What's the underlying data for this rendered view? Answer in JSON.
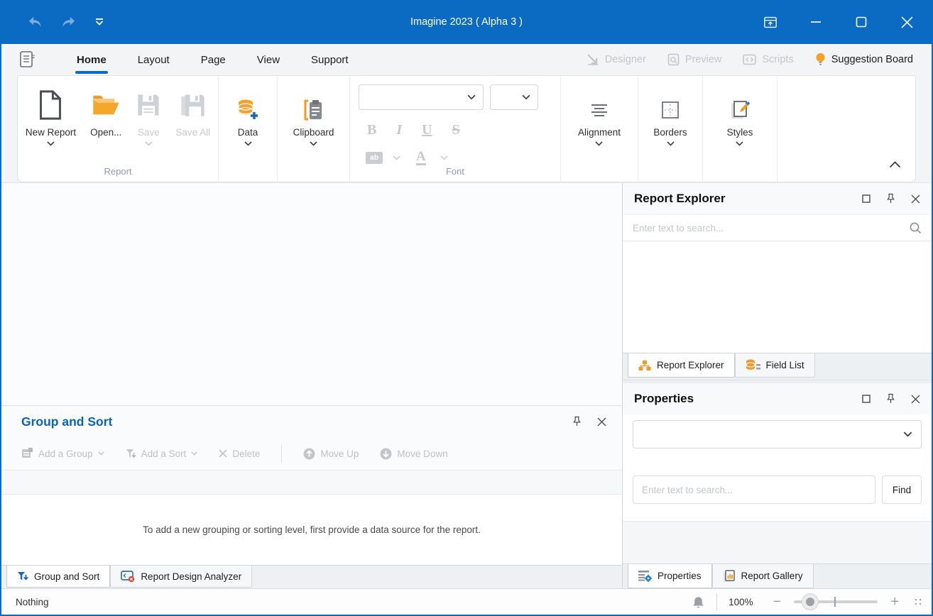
{
  "window": {
    "title": "Imagine 2023 ( Alpha 3 )",
    "status_left": "Nothing",
    "zoom_level": "100%"
  },
  "colors": {
    "accent": "#0b6bc3",
    "orange": "#F29A29"
  },
  "ribbon": {
    "tabs": [
      {
        "label": "Home"
      },
      {
        "label": "Layout"
      },
      {
        "label": "Page"
      },
      {
        "label": "View"
      },
      {
        "label": "Support"
      }
    ],
    "view_buttons": [
      {
        "label": "Designer"
      },
      {
        "label": "Preview"
      },
      {
        "label": "Scripts"
      },
      {
        "label": "Suggestion Board"
      }
    ],
    "report_group": {
      "label": "Report",
      "new_report": "New Report",
      "open": "Open...",
      "save": "Save",
      "save_all": "Save All"
    },
    "data_button": "Data",
    "clipboard_button": "Clipboard",
    "font_group": {
      "label": "Font",
      "bold": "B",
      "italic": "I",
      "underline": "U",
      "strikethrough": "S",
      "highlight": "ab",
      "font_color": "A"
    },
    "alignment_button": "Alignment",
    "borders_button": "Borders",
    "styles_button": "Styles"
  },
  "report_explorer": {
    "title": "Report Explorer",
    "search_placeholder": "Enter text to search...",
    "tabs": [
      {
        "label": "Report Explorer"
      },
      {
        "label": "Field List"
      }
    ]
  },
  "properties": {
    "title": "Properties",
    "search_placeholder": "Enter text to search...",
    "find_button": "Find",
    "tabs": [
      {
        "label": "Properties"
      },
      {
        "label": "Report Gallery"
      }
    ]
  },
  "group_sort": {
    "title": "Group and Sort",
    "toolbar": {
      "add_group": "Add a Group",
      "add_sort": "Add a Sort",
      "delete": "Delete",
      "move_up": "Move Up",
      "move_down": "Move Down"
    },
    "empty_message": "To add a new grouping or sorting level, first provide a data source for the report.",
    "tabs": [
      {
        "label": "Group and Sort"
      },
      {
        "label": "Report Design Analyzer"
      }
    ]
  }
}
